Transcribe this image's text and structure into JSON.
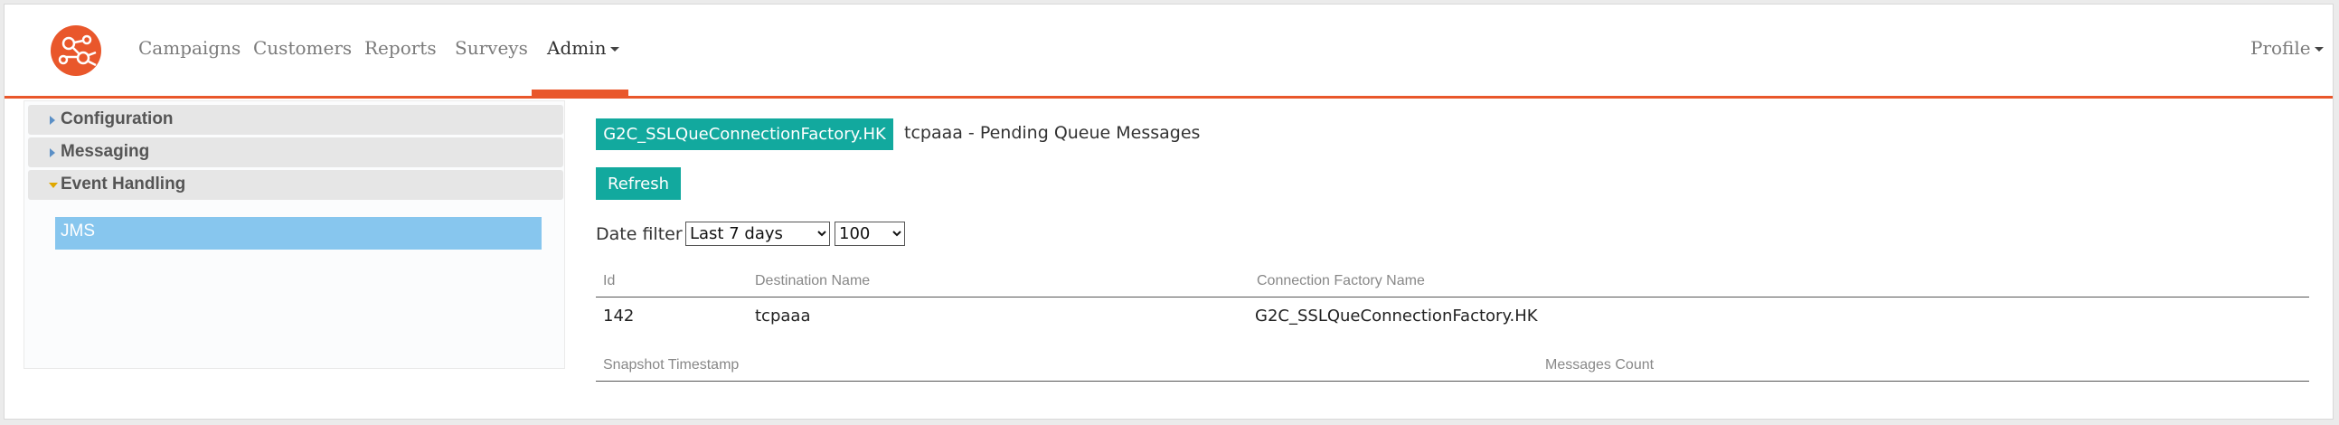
{
  "navbar": {
    "items": [
      {
        "label": "Campaigns"
      },
      {
        "label": "Customers"
      },
      {
        "label": "Reports"
      },
      {
        "label": "Surveys"
      },
      {
        "label": "Admin"
      }
    ],
    "profile": "Profile",
    "accent_color": "#e9572b"
  },
  "sidebar": {
    "sections": [
      {
        "label": "Configuration",
        "expanded": false
      },
      {
        "label": "Messaging",
        "expanded": false
      },
      {
        "label": "Event Handling",
        "expanded": true
      }
    ],
    "selected_item": "JMS",
    "selected_color": "#87c6ee"
  },
  "main": {
    "factory_badge": "G2C_SSLQueConnectionFactory.HK",
    "title": "tcpaaa - Pending Queue Messages",
    "refresh_label": "Refresh",
    "date_filter_label": "Date filter",
    "date_filter_value": "Last 7 days",
    "count_value": "100",
    "button_color": "#12a99e"
  },
  "table1": {
    "headers": [
      "Id",
      "Destination Name",
      "Connection Factory Name"
    ],
    "rows": [
      [
        "142",
        "tcpaaa",
        "G2C_SSLQueConnectionFactory.HK"
      ]
    ]
  },
  "table2": {
    "headers": [
      "Snapshot Timestamp",
      "Messages Count"
    ]
  }
}
